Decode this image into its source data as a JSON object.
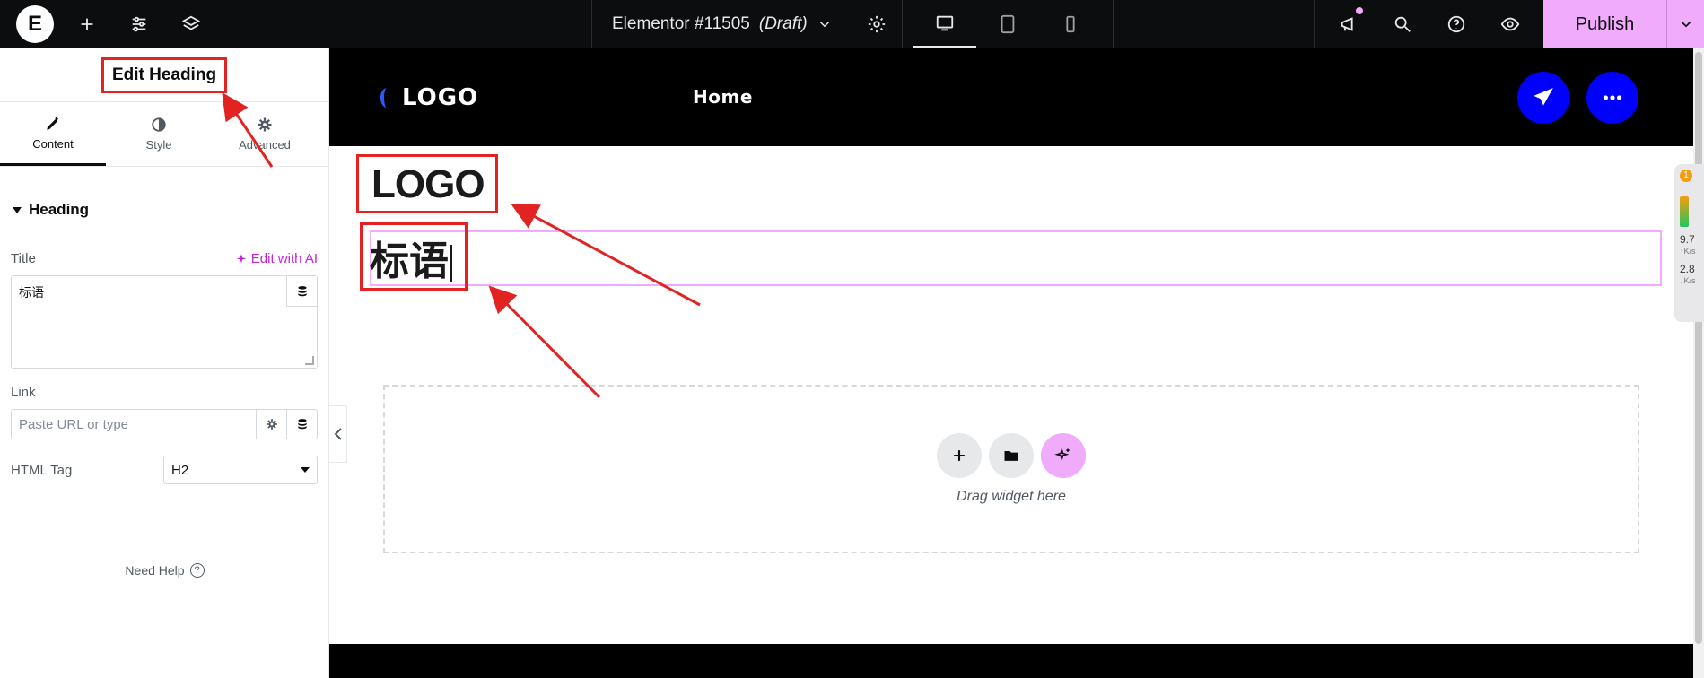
{
  "topbar": {
    "logo_letter": "E",
    "doc_title_main": "Elementor #11505",
    "doc_title_status": "(Draft)",
    "publish_label": "Publish"
  },
  "panel": {
    "title": "Edit Heading",
    "tabs": [
      {
        "label": "Content",
        "icon": "pencil-icon",
        "active": true
      },
      {
        "label": "Style",
        "icon": "half-circle-icon",
        "active": false
      },
      {
        "label": "Advanced",
        "icon": "gear-icon",
        "active": false
      }
    ],
    "section_title": "Heading",
    "title_label": "Title",
    "edit_with_ai": "Edit with AI",
    "title_value": "标语",
    "link_label": "Link",
    "link_placeholder": "Paste URL or type",
    "html_tag_label": "HTML Tag",
    "html_tag_value": "H2",
    "need_help": "Need Help",
    "help_glyph": "?"
  },
  "canvas": {
    "site_logo": "LOGO",
    "nav_home": "Home",
    "heading_logo": "LOGO",
    "heading_slogan": "标语",
    "drop_text": "Drag widget here"
  },
  "speed_widget": {
    "badge": "1",
    "upload": "9.7",
    "download": "2.8",
    "unit": "K/s"
  },
  "colors": {
    "accent": "#f0abfc",
    "annotation": "#e32222",
    "header_bg": "#000000",
    "button_blue": "#0000ff"
  }
}
